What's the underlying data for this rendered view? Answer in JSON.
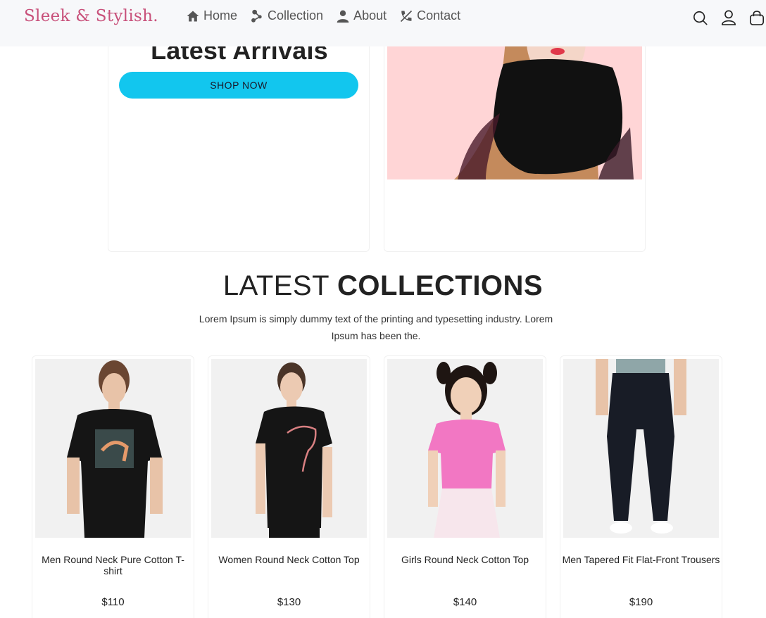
{
  "header": {
    "logo": "Sleek & Stylish.",
    "nav": [
      {
        "label": "Home",
        "icon": "home-icon"
      },
      {
        "label": "Collection",
        "icon": "share-icon"
      },
      {
        "label": "About",
        "icon": "user-icon"
      },
      {
        "label": "Contact",
        "icon": "phone-icon"
      }
    ],
    "icons": [
      "search-icon",
      "account-icon",
      "bag-icon"
    ]
  },
  "hero": {
    "title": "Latest Arrivals",
    "button_label": "SHOP NOW",
    "button_color": "#12c6ee",
    "image_bg": "#ffd5d6"
  },
  "collections": {
    "title_light": "LATEST",
    "title_bold": "COLLECTIONS",
    "description": "Lorem Ipsum is simply dummy text of the printing and typesetting industry. Lorem Ipsum has been the."
  },
  "products": [
    {
      "name": "Men Round Neck Pure Cotton T-shirt",
      "price": "$110"
    },
    {
      "name": "Women Round Neck Cotton Top",
      "price": "$130"
    },
    {
      "name": "Girls Round Neck Cotton Top",
      "price": "$140"
    },
    {
      "name": "Men Tapered Fit Flat-Front Trousers",
      "price": "$190"
    }
  ]
}
